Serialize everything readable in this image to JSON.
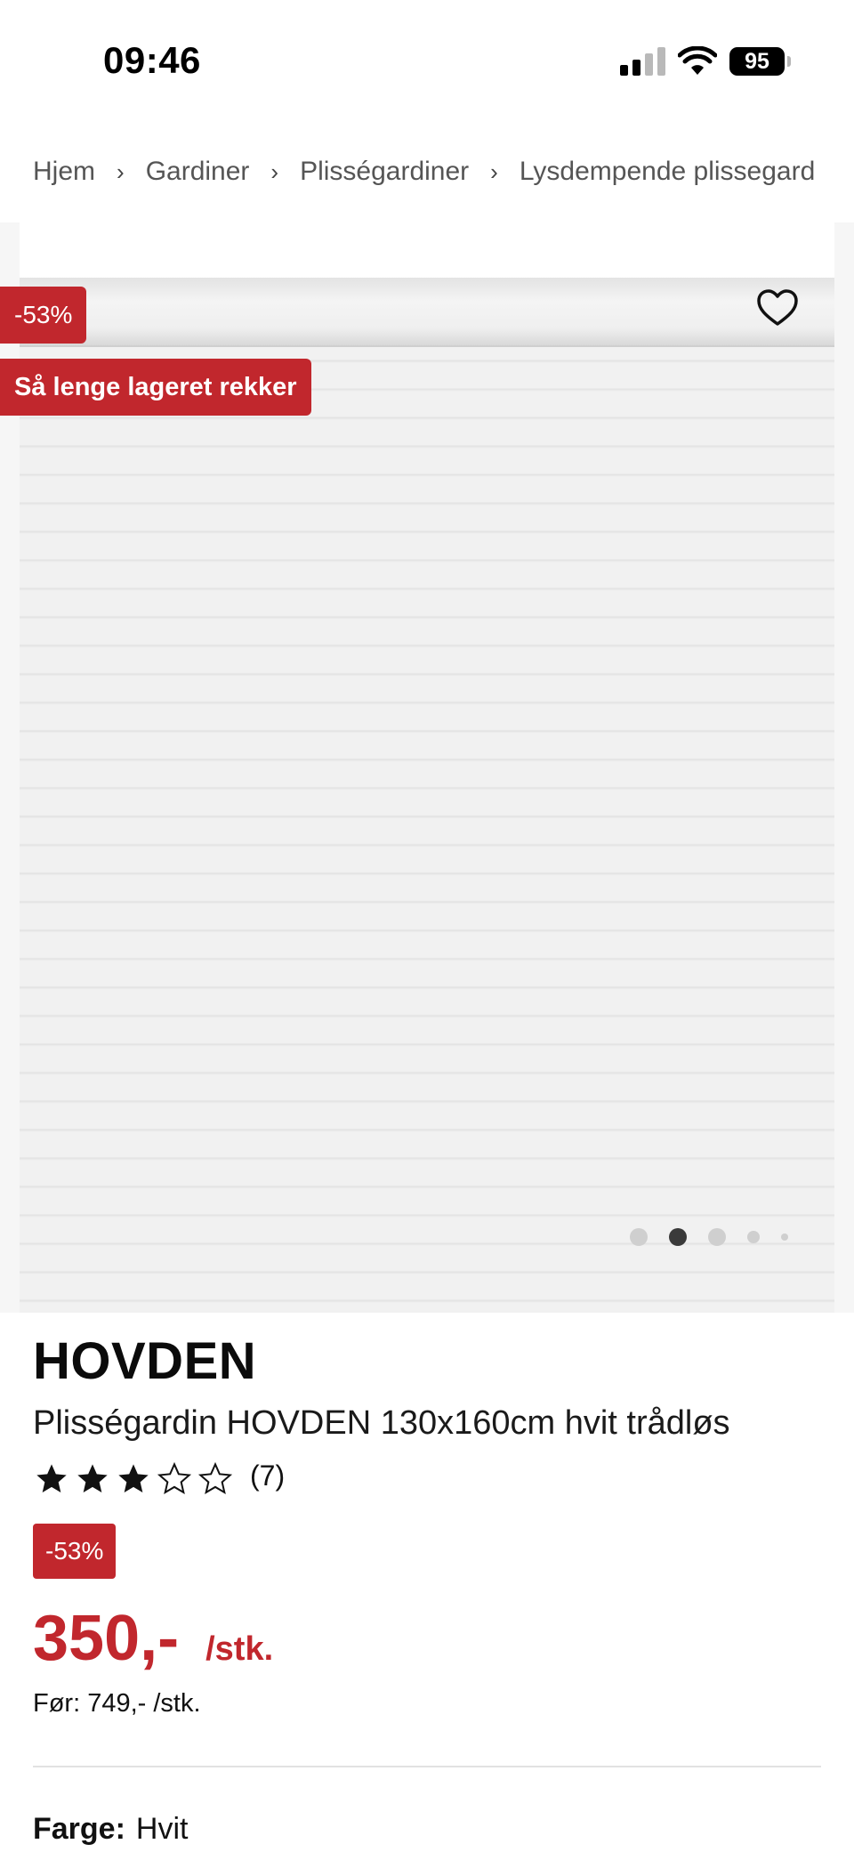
{
  "status_bar": {
    "time": "09:46",
    "battery": "95"
  },
  "breadcrumb": [
    "Hjem",
    "Gardiner",
    "Plisségardiner",
    "Lysdempende plissegard"
  ],
  "gallery": {
    "discount_badge": "-53%",
    "stock_badge": "Så lenge lageret rekker",
    "favorite_icon": "heart-outline-icon",
    "active_dot_index": 1,
    "dot_count": 5
  },
  "product": {
    "brand": "HOVDEN",
    "name": "Plisségardin HOVDEN 130x160cm hvit trådløs",
    "rating": 3,
    "rating_max": 5,
    "rating_count": "(7)",
    "discount_badge": "-53%",
    "price": "350,-",
    "unit": "/stk.",
    "before_price": "Før: 749,- /stk.",
    "color_label": "Farge:",
    "color_value": "Hvit"
  },
  "colors": {
    "accent": "#c1272d",
    "text": "#111111",
    "muted": "#555555"
  }
}
